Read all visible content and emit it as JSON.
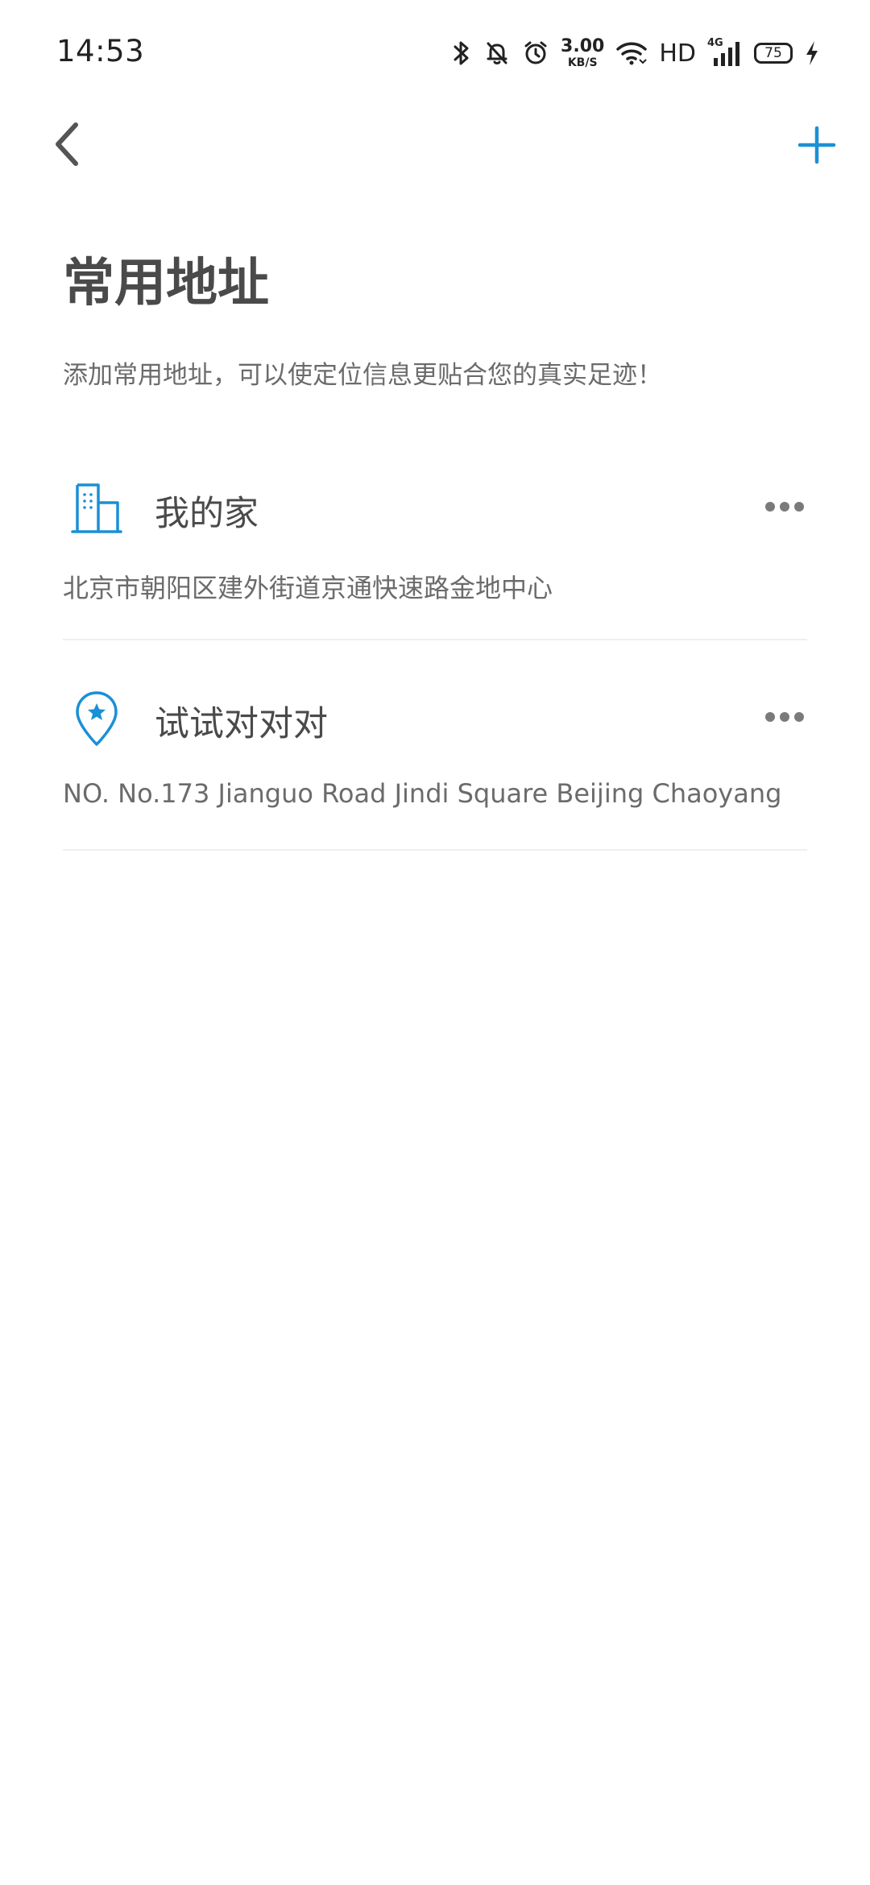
{
  "status_bar": {
    "time": "14:53",
    "net_speed_value": "3.00",
    "net_speed_unit": "KB/S",
    "hd_label": "HD",
    "signal_label": "4G",
    "battery_level": "75",
    "icons": [
      "bluetooth-icon",
      "mute-bell-icon",
      "alarm-icon",
      "wifi-icon",
      "signal-icon",
      "battery-icon",
      "charging-icon"
    ]
  },
  "nav": {
    "back_icon": "chevron-left-icon",
    "add_icon": "plus-icon"
  },
  "header": {
    "title": "常用地址",
    "subtitle": "添加常用地址，可以使定位信息更贴合您的真实足迹！"
  },
  "addresses": [
    {
      "icon": "building-icon",
      "name": "我的家",
      "detail": "北京市朝阳区建外街道京通快速路金地中心"
    },
    {
      "icon": "location-pin-star-icon",
      "name": "试试对对对",
      "detail": "NO. No.173 Jianguo Road Jindi Square Beijing Chaoyang"
    }
  ],
  "colors": {
    "accent": "#1a90d6",
    "text_primary": "#4a4a4a",
    "text_secondary": "#6b6b6b",
    "divider": "#efefef"
  }
}
